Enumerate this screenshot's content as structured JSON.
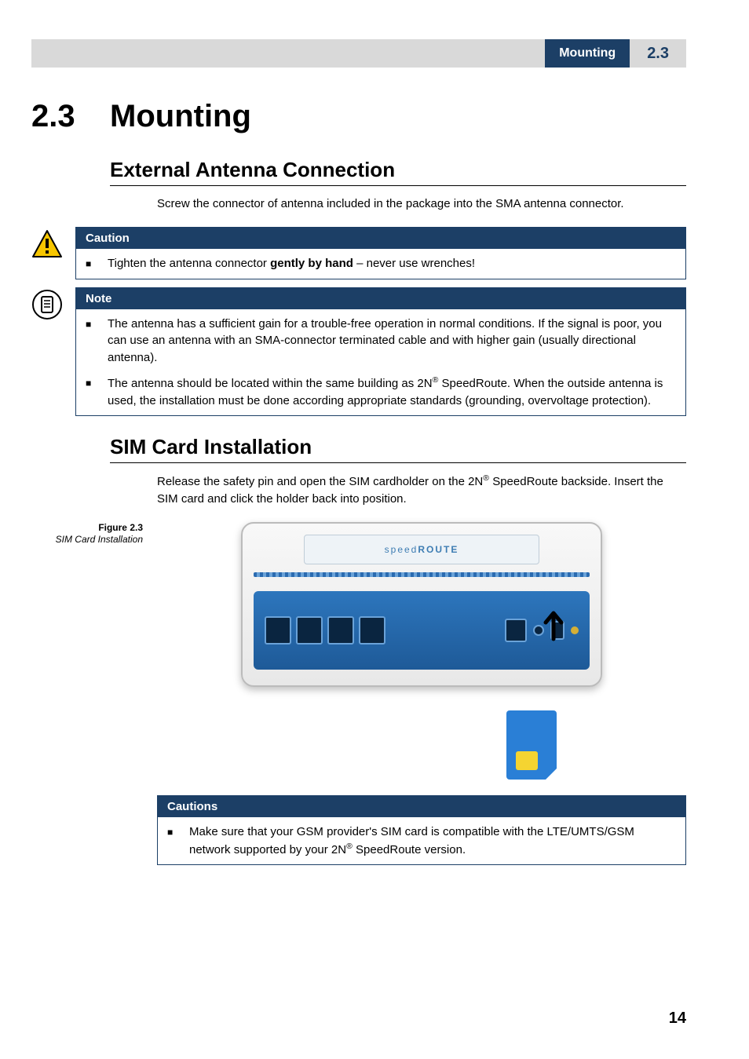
{
  "header": {
    "title": "Mounting",
    "section_number": "2.3"
  },
  "section": {
    "number": "2.3",
    "title": "Mounting"
  },
  "sub1": {
    "heading": "External Antenna Connection",
    "text": "Screw the connector of antenna included in the package into the SMA antenna connector."
  },
  "caution1": {
    "label": "Caution",
    "item_pre": "Tighten the antenna connector ",
    "item_bold": "gently by hand",
    "item_post": " – never use wrenches!"
  },
  "note1": {
    "label": "Note",
    "item1": "The antenna has a sufficient gain for a trouble-free operation in normal conditions. If the signal is poor, you can use an antenna with an SMA-connector terminated cable and with higher gain (usually directional antenna).",
    "item2_pre": "The antenna should be located within the same building as 2N",
    "item2_sup": "®",
    "item2_post": " SpeedRoute. When the outside antenna is used, the installation must be done according appropriate standards (grounding, overvoltage protection)."
  },
  "sub2": {
    "heading": "SIM Card Installation",
    "text_pre": "Release the safety pin and open the SIM cardholder on the 2N",
    "text_sup": "®",
    "text_post": " SpeedRoute backside. Insert the SIM card and click the holder back into position."
  },
  "figure": {
    "label": "Figure 2.3",
    "title": "SIM Card Installation",
    "device_brand_prefix": "speed",
    "device_brand_suffix": "ROUTE"
  },
  "caution2": {
    "label": "Cautions",
    "item_pre": "Make sure that your GSM provider's SIM card is compatible with the LTE/UMTS/GSM network supported by your 2N",
    "item_sup": "®",
    "item_post": " SpeedRoute version."
  },
  "page_number": "14",
  "icons": {
    "caution": "caution-triangle-icon",
    "note": "note-page-icon"
  }
}
